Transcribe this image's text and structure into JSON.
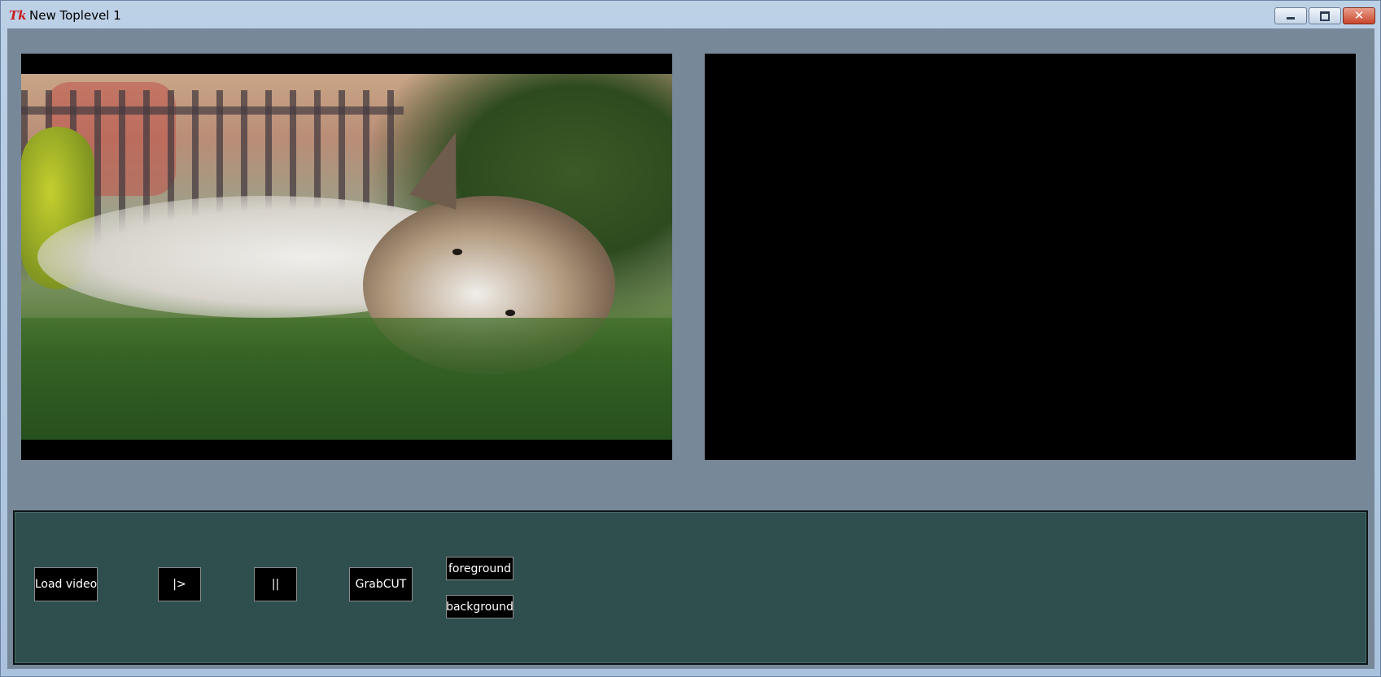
{
  "window": {
    "icon_glyph": "Tk",
    "title": "New Toplevel 1",
    "controls": {
      "minimize": "minimize-icon",
      "maximize": "maximize-icon",
      "close_glyph": "✕"
    }
  },
  "video_left": {
    "content": "video-frame-dog-in-grass"
  },
  "video_right": {
    "content": "empty-black-canvas"
  },
  "controls": {
    "load_video": "Load video",
    "play": "|>",
    "pause": "||",
    "grabcut": "GrabCUT",
    "foreground": "foreground",
    "background": "background"
  },
  "colors": {
    "client_bg": "#778899",
    "control_bar_bg": "#2f4f4f",
    "button_bg": "#000000",
    "button_text": "#ffffff"
  }
}
